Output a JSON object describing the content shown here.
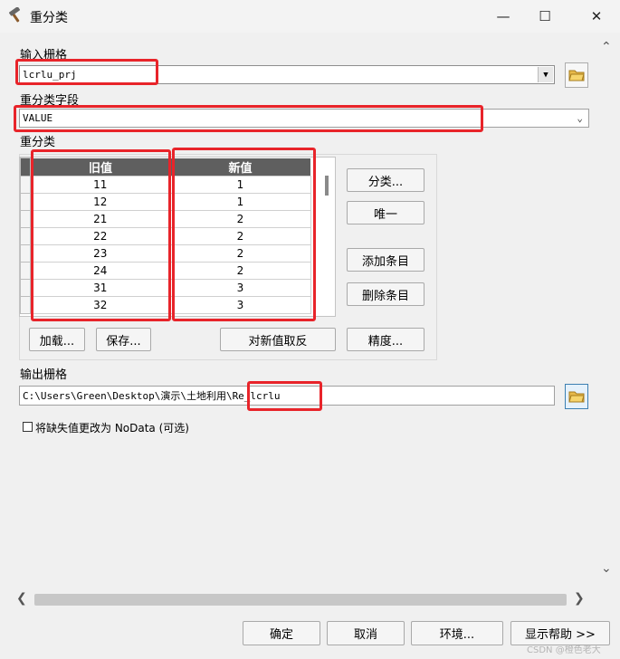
{
  "window": {
    "title": "重分类",
    "minimize": "—",
    "maximize": "☐",
    "close": "✕"
  },
  "input_raster": {
    "label": "输入栅格",
    "value": "lcrlu_prj"
  },
  "reclass_field": {
    "label": "重分类字段",
    "value": "VALUE"
  },
  "reclass": {
    "label": "重分类",
    "columns": [
      "旧值",
      "新值"
    ],
    "rows": [
      {
        "old": "11",
        "new": "1"
      },
      {
        "old": "12",
        "new": "1"
      },
      {
        "old": "21",
        "new": "2"
      },
      {
        "old": "22",
        "new": "2"
      },
      {
        "old": "23",
        "new": "2"
      },
      {
        "old": "24",
        "new": "2"
      },
      {
        "old": "31",
        "new": "3"
      },
      {
        "old": "32",
        "new": "3"
      }
    ],
    "buttons": {
      "classify": "分类...",
      "unique": "唯一",
      "add_entry": "添加条目",
      "delete_entry": "删除条目",
      "load": "加载...",
      "save": "保存...",
      "reverse": "对新值取反",
      "precision": "精度..."
    }
  },
  "output_raster": {
    "label": "输出栅格",
    "value": "C:\\Users\\Green\\Desktop\\演示\\土地利用\\Re_lcrlu"
  },
  "nodata_checkbox": {
    "label": "将缺失值更改为 NoData (可选)",
    "checked": false
  },
  "footer": {
    "ok": "确定",
    "cancel": "取消",
    "env": "环境...",
    "show_help": "显示帮助 >>"
  },
  "watermark": "CSDN @橙色老大",
  "colors": {
    "highlight": "#e8242a",
    "header_bg": "#5f5f5f"
  }
}
